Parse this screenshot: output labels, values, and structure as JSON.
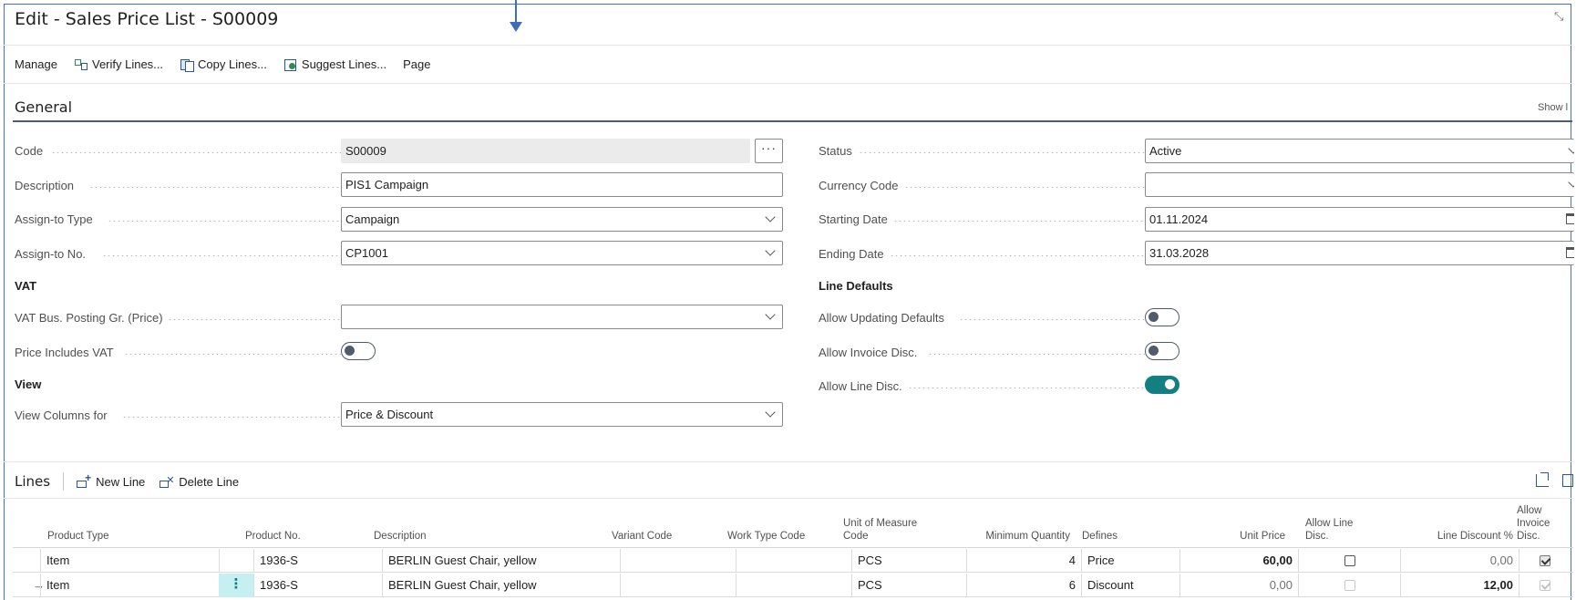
{
  "page": {
    "title": "Edit - Sales Price List - S00009"
  },
  "actions": [
    {
      "label": "Manage",
      "icon": ""
    },
    {
      "label": "Verify Lines...",
      "icon": "verify-lines-icon"
    },
    {
      "label": "Copy Lines...",
      "icon": "copy-lines-icon"
    },
    {
      "label": "Suggest Lines...",
      "icon": "suggest-lines-icon"
    },
    {
      "label": "Page",
      "icon": ""
    }
  ],
  "general": {
    "title": "General",
    "show_more": "Show l",
    "code_label": "Code",
    "code_value": "S00009",
    "description_label": "Description",
    "description_value": "PIS1 Campaign",
    "assign_type_label": "Assign-to Type",
    "assign_type_value": "Campaign",
    "assign_no_label": "Assign-to No.",
    "assign_no_value": "CP1001",
    "vat_group": "VAT",
    "vat_bus_label": "VAT Bus. Posting Gr. (Price)",
    "vat_bus_value": "",
    "price_incl_vat_label": "Price Includes VAT",
    "price_incl_vat_on": false,
    "view_group": "View",
    "view_columns_label": "View Columns for",
    "view_columns_value": "Price & Discount",
    "status_label": "Status",
    "status_value": "Active",
    "currency_label": "Currency Code",
    "currency_value": "",
    "starting_date_label": "Starting Date",
    "starting_date_value": "01.11.2024",
    "ending_date_label": "Ending Date",
    "ending_date_value": "31.03.2028",
    "line_defaults_group": "Line Defaults",
    "allow_updating_label": "Allow Updating Defaults",
    "allow_updating_on": false,
    "allow_invoice_disc_label": "Allow Invoice Disc.",
    "allow_invoice_disc_on": false,
    "allow_line_disc_label": "Allow Line Disc.",
    "allow_line_disc_on": true,
    "toggle_on_color": "#137f83"
  },
  "lines": {
    "title": "Lines",
    "new_line": "New Line",
    "delete_line": "Delete Line",
    "columns": {
      "product_type": "Product Type",
      "product_no": "Product No.",
      "description": "Description",
      "variant_code": "Variant Code",
      "work_type_code": "Work Type Code",
      "uom_line1": "Unit of Measure",
      "uom_line2": "Code",
      "min_qty": "Minimum Quantity",
      "defines": "Defines",
      "unit_price": "Unit Price",
      "allow_line_line1": "Allow Line",
      "allow_line_line2": "Disc.",
      "line_discount": "Line Discount %",
      "allow_inv_line1": "Allow",
      "allow_inv_line2": "Invoice",
      "allow_inv_line3": "Disc."
    },
    "rows": [
      {
        "arrow": "",
        "product_type": "Item",
        "product_no": "1936-S",
        "description": "BERLIN Guest Chair, yellow",
        "variant_code": "",
        "work_type_code": "",
        "uom": "PCS",
        "min_qty": "4",
        "defines": "Price",
        "unit_price": "60,00",
        "allow_line_disc": false,
        "line_discount": "0,00",
        "allow_inv_disc": true
      },
      {
        "arrow": "→",
        "product_type": "Item",
        "product_no": "1936-S",
        "description": "BERLIN Guest Chair, yellow",
        "variant_code": "",
        "work_type_code": "",
        "uom": "PCS",
        "min_qty": "6",
        "defines": "Discount",
        "unit_price": "0,00",
        "allow_line_disc": false,
        "line_discount": "12,00",
        "allow_inv_disc": true
      }
    ]
  }
}
